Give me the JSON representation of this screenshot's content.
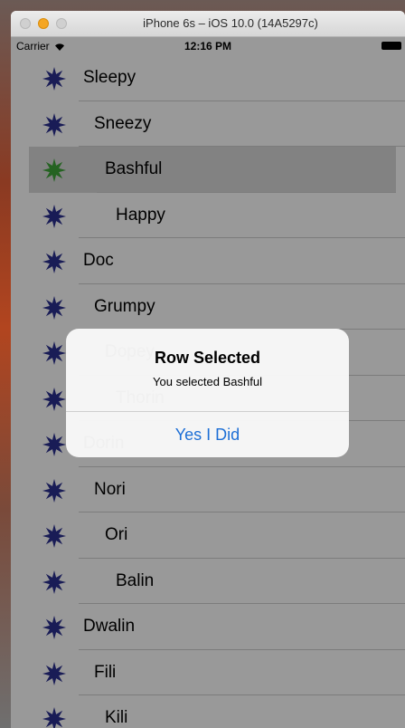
{
  "window": {
    "title": "iPhone 6s – iOS 10.0 (14A5297c)"
  },
  "status_bar": {
    "carrier": "Carrier",
    "time": "12:16 PM"
  },
  "rows": [
    {
      "label": "Sleepy",
      "indent": 0,
      "selected": false
    },
    {
      "label": "Sneezy",
      "indent": 1,
      "selected": false
    },
    {
      "label": "Bashful",
      "indent": 2,
      "selected": true
    },
    {
      "label": "Happy",
      "indent": 3,
      "selected": false
    },
    {
      "label": "Doc",
      "indent": 0,
      "selected": false
    },
    {
      "label": "Grumpy",
      "indent": 1,
      "selected": false
    },
    {
      "label": "Dopey",
      "indent": 2,
      "selected": false
    },
    {
      "label": "Thorin",
      "indent": 3,
      "selected": false
    },
    {
      "label": "Dorin",
      "indent": 0,
      "selected": false
    },
    {
      "label": "Nori",
      "indent": 1,
      "selected": false
    },
    {
      "label": "Ori",
      "indent": 2,
      "selected": false
    },
    {
      "label": "Balin",
      "indent": 3,
      "selected": false
    },
    {
      "label": "Dwalin",
      "indent": 0,
      "selected": false
    },
    {
      "label": "Fili",
      "indent": 1,
      "selected": false
    },
    {
      "label": "Kili",
      "indent": 2,
      "selected": false
    }
  ],
  "icons": {
    "row_icon": "star-icon",
    "row_icon_color": "#2b2f8f",
    "selected_icon_color": "#3ea53a"
  },
  "alert": {
    "title": "Row Selected",
    "message": "You selected Bashful",
    "button": "Yes I Did"
  },
  "colors": {
    "accent": "#1d6fd6"
  }
}
